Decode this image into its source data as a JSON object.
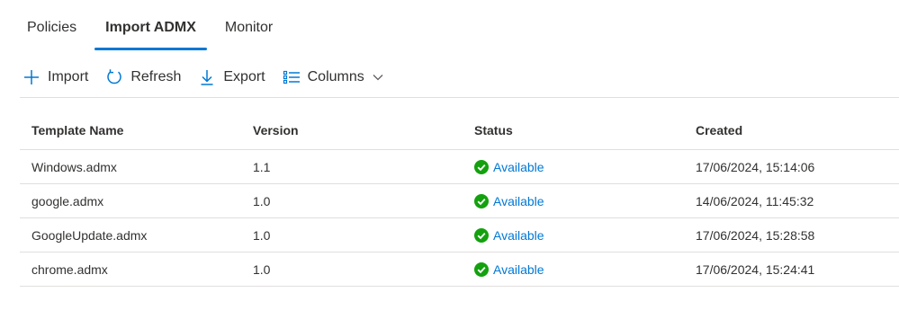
{
  "tabs": [
    {
      "label": "Policies",
      "active": false
    },
    {
      "label": "Import ADMX",
      "active": true
    },
    {
      "label": "Monitor",
      "active": false
    }
  ],
  "toolbar": {
    "import": {
      "label": "Import",
      "icon": "plus-icon"
    },
    "refresh": {
      "label": "Refresh",
      "icon": "refresh-icon"
    },
    "export": {
      "label": "Export",
      "icon": "download-icon"
    },
    "columns": {
      "label": "Columns",
      "icon": "columns-icon"
    }
  },
  "table": {
    "headers": [
      "Template Name",
      "Version",
      "Status",
      "Created"
    ],
    "rows": [
      {
        "name": "Windows.admx",
        "version": "1.1",
        "status": "Available",
        "created": "17/06/2024, 15:14:06"
      },
      {
        "name": "google.admx",
        "version": "1.0",
        "status": "Available",
        "created": "14/06/2024, 11:45:32"
      },
      {
        "name": "GoogleUpdate.admx",
        "version": "1.0",
        "status": "Available",
        "created": "17/06/2024, 15:28:58"
      },
      {
        "name": "chrome.admx",
        "version": "1.0",
        "status": "Available",
        "created": "17/06/2024, 15:24:41"
      }
    ]
  },
  "colors": {
    "accent": "#0078d4",
    "success": "#13a10e",
    "text": "#323130",
    "divider": "#e1dfdd"
  }
}
